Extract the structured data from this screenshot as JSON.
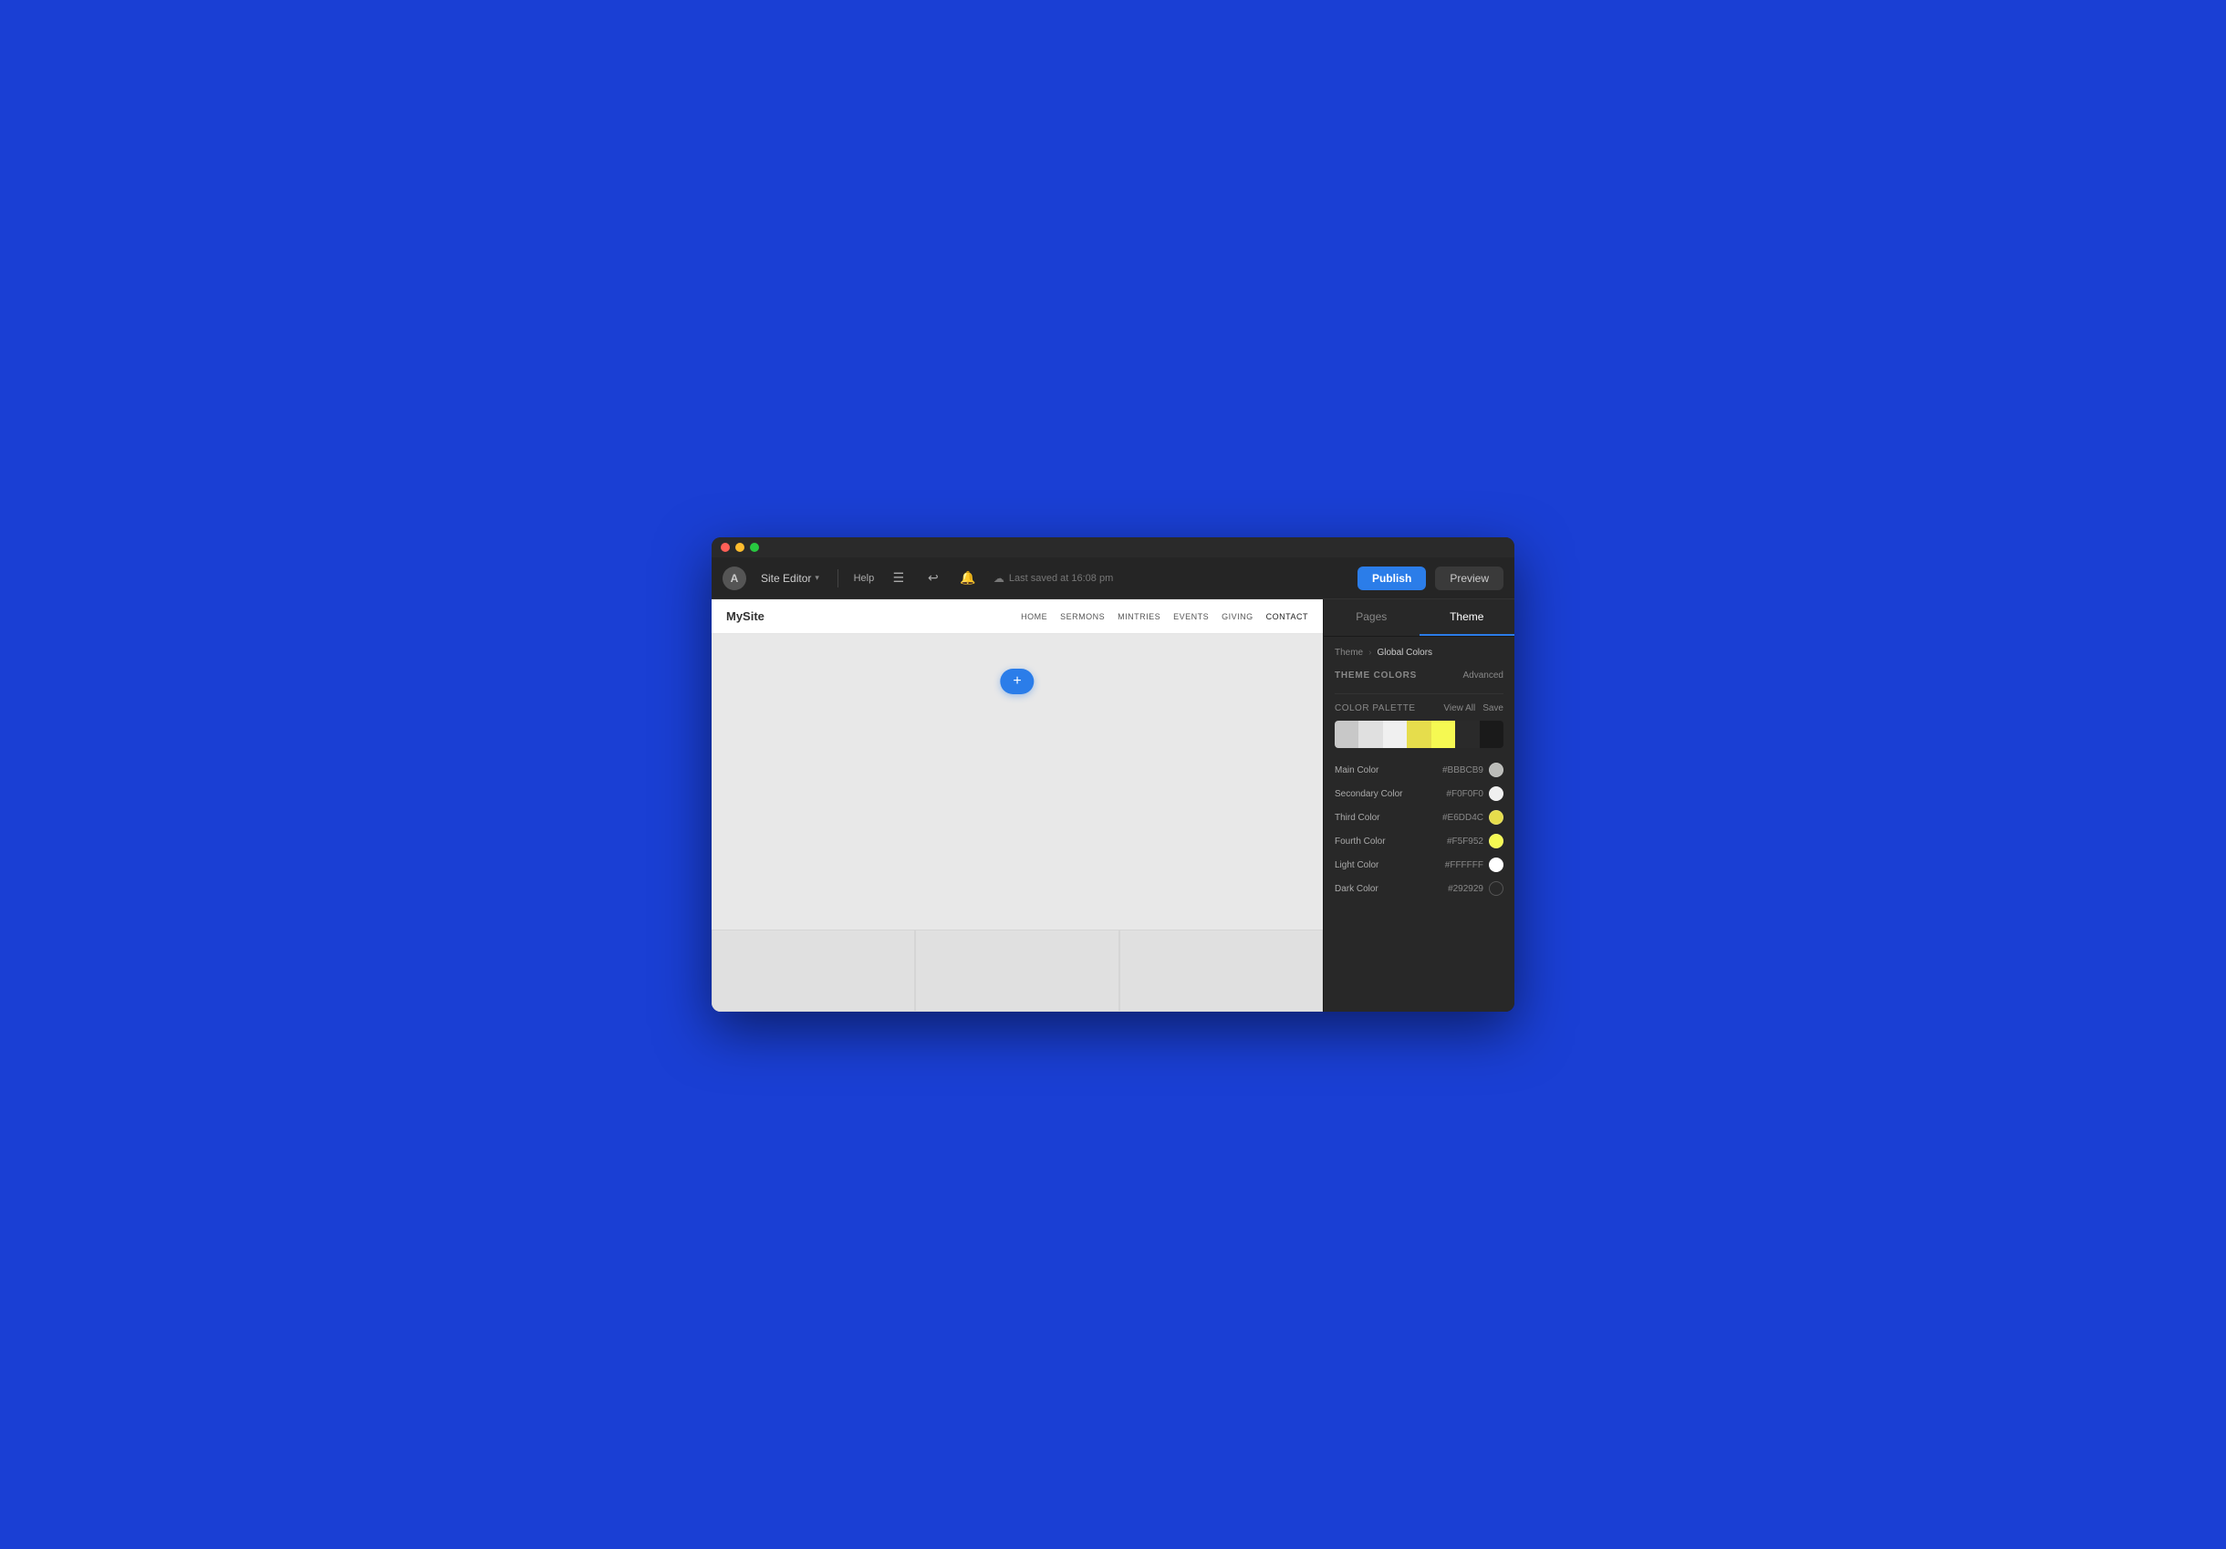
{
  "window": {
    "title": "Site Editor"
  },
  "titleBar": {
    "dots": [
      "red",
      "yellow",
      "green"
    ]
  },
  "toolbar": {
    "logo": "A",
    "siteEditor": "Site Editor",
    "help": "Help",
    "savedText": "Last saved at 16:08 pm",
    "publishLabel": "Publish",
    "previewLabel": "Preview"
  },
  "sitePreview": {
    "logo": "MySite",
    "navLinks": [
      "HOME",
      "SERMONS",
      "MINTRIES",
      "EVENTS",
      "GIVING",
      "CONTACT"
    ],
    "addSectionPlus": "+"
  },
  "rightPanel": {
    "tabs": [
      {
        "label": "Pages",
        "active": false
      },
      {
        "label": "Theme",
        "active": true
      }
    ],
    "breadcrumb": {
      "parent": "Theme",
      "current": "Global Colors"
    },
    "themeColors": {
      "title": "THEME COLORS",
      "advancedBtn": "Advanced"
    },
    "colorPalette": {
      "label": "COLOR  PALETTE",
      "viewAll": "View All",
      "save": "Save",
      "strips": [
        {
          "color": "#c8c8c8"
        },
        {
          "color": "#e8e8e8"
        },
        {
          "color": "#f0f0f0"
        },
        {
          "color": "#E6DD4C"
        },
        {
          "color": "#F5F952"
        },
        {
          "color": "#1a1a1a"
        },
        {
          "color": "#292929"
        }
      ]
    },
    "colors": [
      {
        "label": "Main Color",
        "hex": "#BBBCB9",
        "swatch": "#BBBCB9"
      },
      {
        "label": "Secondary Color",
        "hex": "#F0F0F0",
        "swatch": "#F0F0F0"
      },
      {
        "label": "Third Color",
        "hex": "#E6DD4C",
        "swatch": "#E6DD4C"
      },
      {
        "label": "Fourth Color",
        "hex": "#F5F952",
        "swatch": "#F5F952"
      },
      {
        "label": "Light Color",
        "hex": "#FFFFFF",
        "swatch": "#FFFFFF"
      },
      {
        "label": "Dark Color",
        "hex": "#292929",
        "swatch": "#292929"
      }
    ]
  }
}
